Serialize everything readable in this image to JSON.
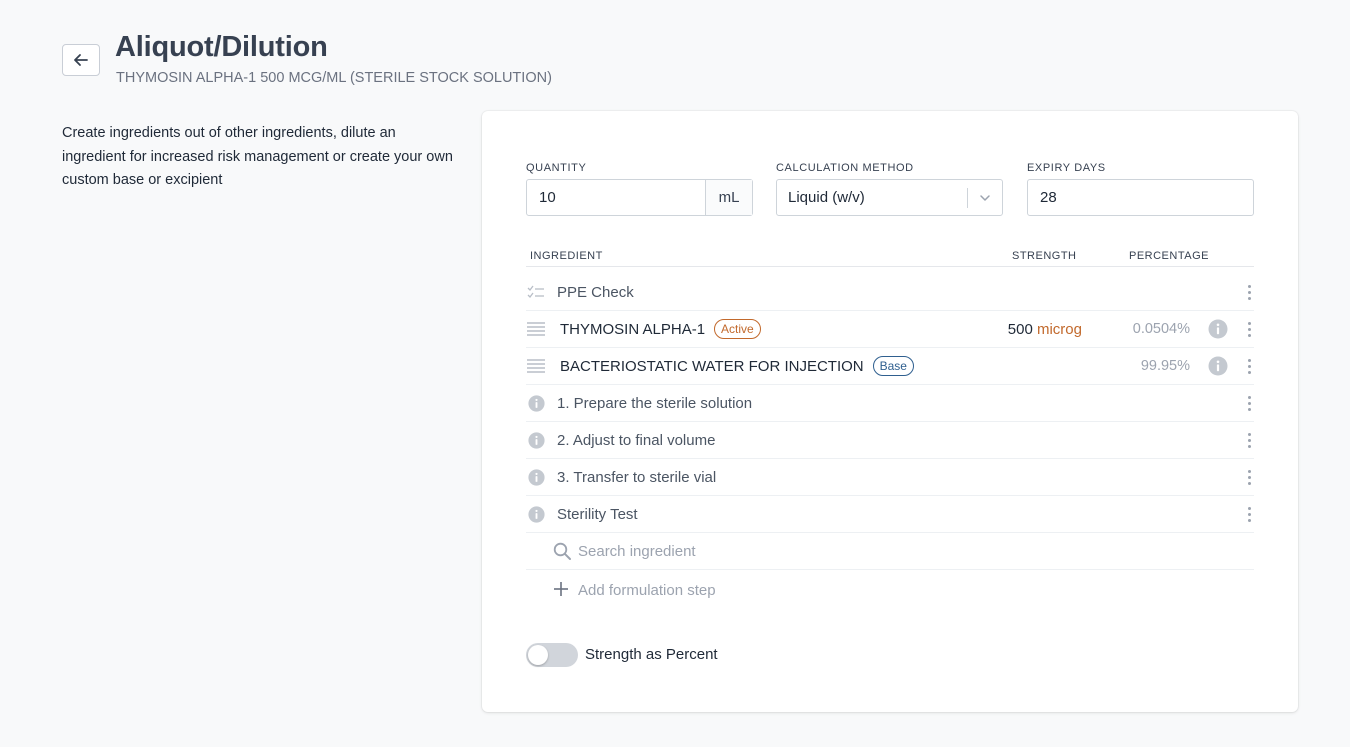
{
  "header": {
    "title": "Aliquot/Dilution",
    "subtitle": "THYMOSIN ALPHA-1 500 MCG/ML (STERILE STOCK SOLUTION)",
    "back_icon": "arrow-left-icon"
  },
  "description": "Create ingredients out of other ingredients, dilute an ingredient for increased risk management or create your own custom base or excipient",
  "form": {
    "quantity": {
      "label": "QUANTITY",
      "value": "10",
      "unit": "mL"
    },
    "calculation_method": {
      "label": "CALCULATION METHOD",
      "value": "Liquid (w/v)"
    },
    "expiry_days": {
      "label": "EXPIRY DAYS",
      "value": "28"
    }
  },
  "table": {
    "headers": {
      "ingredient": "INGREDIENT",
      "strength": "STRENGTH",
      "percentage": "PERCENTAGE"
    },
    "rows": [
      {
        "type": "check",
        "icon": "checklist-icon",
        "label": "PPE Check"
      },
      {
        "type": "ingredient",
        "icon": "drag-handle-icon",
        "label": "THYMOSIN ALPHA-1",
        "badge": "Active",
        "strength_value": "500",
        "strength_unit": "microg",
        "percentage": "0.0504%"
      },
      {
        "type": "ingredient",
        "icon": "drag-handle-icon",
        "label": "BACTERIOSTATIC WATER FOR INJECTION",
        "badge": "Base",
        "percentage": "99.95%"
      },
      {
        "type": "step",
        "icon": "info-icon",
        "label": "1. Prepare the sterile solution"
      },
      {
        "type": "step",
        "icon": "info-icon",
        "label": "2. Adjust to final volume"
      },
      {
        "type": "step",
        "icon": "info-icon",
        "label": "3. Transfer to sterile vial"
      },
      {
        "type": "step",
        "icon": "info-icon",
        "label": "Sterility Test"
      }
    ],
    "search_placeholder": "Search ingredient",
    "add_step_label": "Add formulation step"
  },
  "toggle": {
    "label": "Strength as Percent",
    "on": false
  },
  "colors": {
    "accent_orange": "#c2692c",
    "accent_blue": "#2f5f8f",
    "muted": "#9ca3af"
  }
}
